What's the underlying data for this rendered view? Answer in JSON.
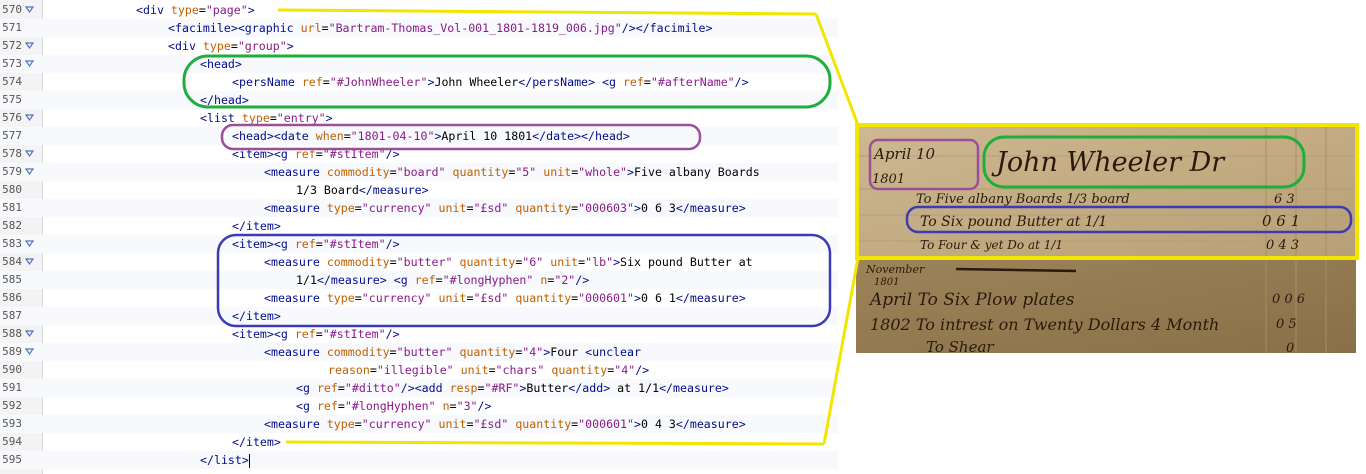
{
  "editor": {
    "lines": [
      {
        "num": "570",
        "fold": true,
        "indent": 0,
        "tokens": [
          [
            "tag",
            "<div"
          ],
          [
            "tx",
            " "
          ],
          [
            "an",
            "type"
          ],
          [
            "tx",
            "="
          ],
          [
            "av",
            "\"page\""
          ],
          [
            "tag",
            ">"
          ]
        ]
      },
      {
        "num": "571",
        "fold": false,
        "indent": 1,
        "tokens": [
          [
            "tag",
            "<"
          ],
          [
            "tag",
            "facimile"
          ],
          [
            "tag",
            ">"
          ],
          [
            "tag",
            "<"
          ],
          [
            "tag",
            "graphic"
          ],
          [
            "tx",
            " "
          ],
          [
            "an",
            "url"
          ],
          [
            "tx",
            "="
          ],
          [
            "av",
            "\"Bartram-Thomas_Vol-001_1801-1819_006.jpg\""
          ],
          [
            "tag",
            "/></facimile>"
          ]
        ]
      },
      {
        "num": "572",
        "fold": true,
        "indent": 1,
        "tokens": [
          [
            "tag",
            "<div"
          ],
          [
            "tx",
            " "
          ],
          [
            "an",
            "type"
          ],
          [
            "tx",
            "="
          ],
          [
            "av",
            "\"group\""
          ],
          [
            "tag",
            ">"
          ]
        ]
      },
      {
        "num": "573",
        "fold": true,
        "indent": 2,
        "tokens": [
          [
            "tag",
            "<head>"
          ]
        ]
      },
      {
        "num": "574",
        "fold": false,
        "indent": 3,
        "tokens": [
          [
            "tag",
            "<persName"
          ],
          [
            "tx",
            " "
          ],
          [
            "an",
            "ref"
          ],
          [
            "tx",
            "="
          ],
          [
            "av",
            "\"#JohnWheeler\""
          ],
          [
            "tag",
            ">"
          ],
          [
            "tx",
            "John Wheeler"
          ],
          [
            "tag",
            "</persName>"
          ],
          [
            "tx",
            " "
          ],
          [
            "tag",
            "<g"
          ],
          [
            "tx",
            " "
          ],
          [
            "an",
            "ref"
          ],
          [
            "tx",
            "="
          ],
          [
            "av",
            "\"#afterName\""
          ],
          [
            "tag",
            "/>"
          ]
        ]
      },
      {
        "num": "575",
        "fold": false,
        "indent": 2,
        "tokens": [
          [
            "tag",
            "</head>"
          ]
        ]
      },
      {
        "num": "576",
        "fold": true,
        "indent": 2,
        "tokens": [
          [
            "tag",
            "<list"
          ],
          [
            "tx",
            " "
          ],
          [
            "an",
            "type"
          ],
          [
            "tx",
            "="
          ],
          [
            "av",
            "\"entry\""
          ],
          [
            "tag",
            ">"
          ]
        ]
      },
      {
        "num": "577",
        "fold": false,
        "indent": 3,
        "tokens": [
          [
            "tag",
            "<head><date"
          ],
          [
            "tx",
            " "
          ],
          [
            "an",
            "when"
          ],
          [
            "tx",
            "="
          ],
          [
            "av",
            "\"1801-04-10\""
          ],
          [
            "tag",
            ">"
          ],
          [
            "tx",
            "April 10 1801"
          ],
          [
            "tag",
            "</date></head>"
          ]
        ]
      },
      {
        "num": "578",
        "fold": true,
        "indent": 3,
        "tokens": [
          [
            "tag",
            "<item><g"
          ],
          [
            "tx",
            " "
          ],
          [
            "an",
            "ref"
          ],
          [
            "tx",
            "="
          ],
          [
            "av",
            "\"#stItem\""
          ],
          [
            "tag",
            "/>"
          ]
        ]
      },
      {
        "num": "579",
        "fold": true,
        "indent": 4,
        "tokens": [
          [
            "tag",
            "<measure"
          ],
          [
            "tx",
            " "
          ],
          [
            "an",
            "commodity"
          ],
          [
            "tx",
            "="
          ],
          [
            "av",
            "\"board\""
          ],
          [
            "tx",
            " "
          ],
          [
            "an",
            "quantity"
          ],
          [
            "tx",
            "="
          ],
          [
            "av",
            "\"5\""
          ],
          [
            "tx",
            " "
          ],
          [
            "an",
            "unit"
          ],
          [
            "tx",
            "="
          ],
          [
            "av",
            "\"whole\""
          ],
          [
            "tag",
            ">"
          ],
          [
            "tx",
            "Five albany Boards"
          ]
        ]
      },
      {
        "num": "580",
        "fold": false,
        "indent": 5,
        "tokens": [
          [
            "tx",
            "1/3 Board"
          ],
          [
            "tag",
            "</measure>"
          ]
        ]
      },
      {
        "num": "581",
        "fold": false,
        "indent": 4,
        "tokens": [
          [
            "tag",
            "<measure"
          ],
          [
            "tx",
            " "
          ],
          [
            "an",
            "type"
          ],
          [
            "tx",
            "="
          ],
          [
            "av",
            "\"currency\""
          ],
          [
            "tx",
            " "
          ],
          [
            "an",
            "unit"
          ],
          [
            "tx",
            "="
          ],
          [
            "av",
            "\"£sd\""
          ],
          [
            "tx",
            " "
          ],
          [
            "an",
            "quantity"
          ],
          [
            "tx",
            "="
          ],
          [
            "av",
            "\"000603\""
          ],
          [
            "tag",
            ">"
          ],
          [
            "tx",
            "0 6 3"
          ],
          [
            "tag",
            "</measure>"
          ]
        ]
      },
      {
        "num": "582",
        "fold": false,
        "indent": 3,
        "tokens": [
          [
            "tag",
            "</item>"
          ]
        ]
      },
      {
        "num": "583",
        "fold": true,
        "indent": 3,
        "tokens": [
          [
            "tag",
            "<item><g"
          ],
          [
            "tx",
            " "
          ],
          [
            "an",
            "ref"
          ],
          [
            "tx",
            "="
          ],
          [
            "av",
            "\"#stItem\""
          ],
          [
            "tag",
            "/>"
          ]
        ]
      },
      {
        "num": "584",
        "fold": true,
        "indent": 4,
        "tokens": [
          [
            "tag",
            "<measure"
          ],
          [
            "tx",
            " "
          ],
          [
            "an",
            "commodity"
          ],
          [
            "tx",
            "="
          ],
          [
            "av",
            "\"butter\""
          ],
          [
            "tx",
            " "
          ],
          [
            "an",
            "quantity"
          ],
          [
            "tx",
            "="
          ],
          [
            "av",
            "\"6\""
          ],
          [
            "tx",
            " "
          ],
          [
            "an",
            "unit"
          ],
          [
            "tx",
            "="
          ],
          [
            "av",
            "\"lb\""
          ],
          [
            "tag",
            ">"
          ],
          [
            "tx",
            "Six pound Butter at"
          ]
        ]
      },
      {
        "num": "585",
        "fold": false,
        "indent": 5,
        "tokens": [
          [
            "tx",
            "1/1"
          ],
          [
            "tag",
            "</measure>"
          ],
          [
            "tx",
            " "
          ],
          [
            "tag",
            "<g"
          ],
          [
            "tx",
            " "
          ],
          [
            "an",
            "ref"
          ],
          [
            "tx",
            "="
          ],
          [
            "av",
            "\"#longHyphen\""
          ],
          [
            "tx",
            " "
          ],
          [
            "an",
            "n"
          ],
          [
            "tx",
            "="
          ],
          [
            "av",
            "\"2\""
          ],
          [
            "tag",
            "/>"
          ]
        ]
      },
      {
        "num": "586",
        "fold": false,
        "indent": 4,
        "tokens": [
          [
            "tag",
            "<measure"
          ],
          [
            "tx",
            " "
          ],
          [
            "an",
            "type"
          ],
          [
            "tx",
            "="
          ],
          [
            "av",
            "\"currency\""
          ],
          [
            "tx",
            " "
          ],
          [
            "an",
            "unit"
          ],
          [
            "tx",
            "="
          ],
          [
            "av",
            "\"£sd\""
          ],
          [
            "tx",
            " "
          ],
          [
            "an",
            "quantity"
          ],
          [
            "tx",
            "="
          ],
          [
            "av",
            "\"000601\""
          ],
          [
            "tag",
            ">"
          ],
          [
            "tx",
            "0 6 1"
          ],
          [
            "tag",
            "</measure>"
          ]
        ]
      },
      {
        "num": "587",
        "fold": false,
        "indent": 3,
        "tokens": [
          [
            "tag",
            "</item>"
          ]
        ]
      },
      {
        "num": "588",
        "fold": true,
        "indent": 3,
        "tokens": [
          [
            "tag",
            "<item><g"
          ],
          [
            "tx",
            " "
          ],
          [
            "an",
            "ref"
          ],
          [
            "tx",
            "="
          ],
          [
            "av",
            "\"#stItem\""
          ],
          [
            "tag",
            "/>"
          ]
        ]
      },
      {
        "num": "589",
        "fold": true,
        "indent": 4,
        "tokens": [
          [
            "tag",
            "<measure"
          ],
          [
            "tx",
            " "
          ],
          [
            "an",
            "commodity"
          ],
          [
            "tx",
            "="
          ],
          [
            "av",
            "\"butter\""
          ],
          [
            "tx",
            " "
          ],
          [
            "an",
            "quantity"
          ],
          [
            "tx",
            "="
          ],
          [
            "av",
            "\"4\""
          ],
          [
            "tag",
            ">"
          ],
          [
            "tx",
            "Four "
          ],
          [
            "tag",
            "<unclear"
          ]
        ]
      },
      {
        "num": "590",
        "fold": false,
        "indent": 6,
        "tokens": [
          [
            "an",
            "reason"
          ],
          [
            "tx",
            "="
          ],
          [
            "av",
            "\"illegible\""
          ],
          [
            "tx",
            " "
          ],
          [
            "an",
            "unit"
          ],
          [
            "tx",
            "="
          ],
          [
            "av",
            "\"chars\""
          ],
          [
            "tx",
            " "
          ],
          [
            "an",
            "quantity"
          ],
          [
            "tx",
            "="
          ],
          [
            "av",
            "\"4\""
          ],
          [
            "tag",
            "/>"
          ]
        ]
      },
      {
        "num": "591",
        "fold": false,
        "indent": 5,
        "tokens": [
          [
            "tag",
            "<g"
          ],
          [
            "tx",
            " "
          ],
          [
            "an",
            "ref"
          ],
          [
            "tx",
            "="
          ],
          [
            "av",
            "\"#ditto\""
          ],
          [
            "tag",
            "/><add"
          ],
          [
            "tx",
            " "
          ],
          [
            "an",
            "resp"
          ],
          [
            "tx",
            "="
          ],
          [
            "av",
            "\"#RF\""
          ],
          [
            "tag",
            ">"
          ],
          [
            "tx",
            "Butter"
          ],
          [
            "tag",
            "</add>"
          ],
          [
            "tx",
            " at 1/1"
          ],
          [
            "tag",
            "</measure>"
          ]
        ]
      },
      {
        "num": "592",
        "fold": false,
        "indent": 5,
        "tokens": [
          [
            "tag",
            "<g"
          ],
          [
            "tx",
            " "
          ],
          [
            "an",
            "ref"
          ],
          [
            "tx",
            "="
          ],
          [
            "av",
            "\"#longHyphen\""
          ],
          [
            "tx",
            " "
          ],
          [
            "an",
            "n"
          ],
          [
            "tx",
            "="
          ],
          [
            "av",
            "\"3\""
          ],
          [
            "tag",
            "/>"
          ]
        ]
      },
      {
        "num": "593",
        "fold": false,
        "indent": 4,
        "tokens": [
          [
            "tag",
            "<measure"
          ],
          [
            "tx",
            " "
          ],
          [
            "an",
            "type"
          ],
          [
            "tx",
            "="
          ],
          [
            "av",
            "\"currency\""
          ],
          [
            "tx",
            " "
          ],
          [
            "an",
            "unit"
          ],
          [
            "tx",
            "="
          ],
          [
            "av",
            "\"£sd\""
          ],
          [
            "tx",
            " "
          ],
          [
            "an",
            "quantity"
          ],
          [
            "tx",
            "="
          ],
          [
            "av",
            "\"000601\""
          ],
          [
            "tag",
            ">"
          ],
          [
            "tx",
            "0 4 3"
          ],
          [
            "tag",
            "</measure>"
          ]
        ]
      },
      {
        "num": "594",
        "fold": false,
        "indent": 3,
        "tokens": [
          [
            "tag",
            "</item>"
          ]
        ]
      },
      {
        "num": "595",
        "fold": false,
        "indent": 2,
        "tokens": [
          [
            "tag",
            "</list>"
          ]
        ],
        "caret": true
      }
    ]
  },
  "manuscript": {
    "top": {
      "date_line1": "April 10",
      "date_line2": "1801",
      "name": "John Wheeler Dr",
      "row1": "To Five albany Boards 1/3 board",
      "row1_amount": "6  3",
      "row2": "To Six pound Butter at 1/1",
      "row2_amount": "0  6  1",
      "row3": "To Four & yet Do at 1/1",
      "row3_amount": "0  4  3"
    },
    "bottom": {
      "row0": "November",
      "row0b": "1801",
      "row1": "April To Six Plow plates",
      "row1_amount": "0  0  6",
      "row2": "1802 To intrest on Twenty Dollars 4 Month",
      "row2_amount": "0  5",
      "row3": "To Shear",
      "row3_amount": "0"
    }
  },
  "colors": {
    "yellow": "#f2e600",
    "green": "#1fae3c",
    "purple": "#9b4f9b",
    "blue": "#3b3bb4",
    "tag": "#000c8c",
    "attr_name": "#c06000",
    "attr_value": "#8a1a8a",
    "paper": "#c9b48f"
  }
}
